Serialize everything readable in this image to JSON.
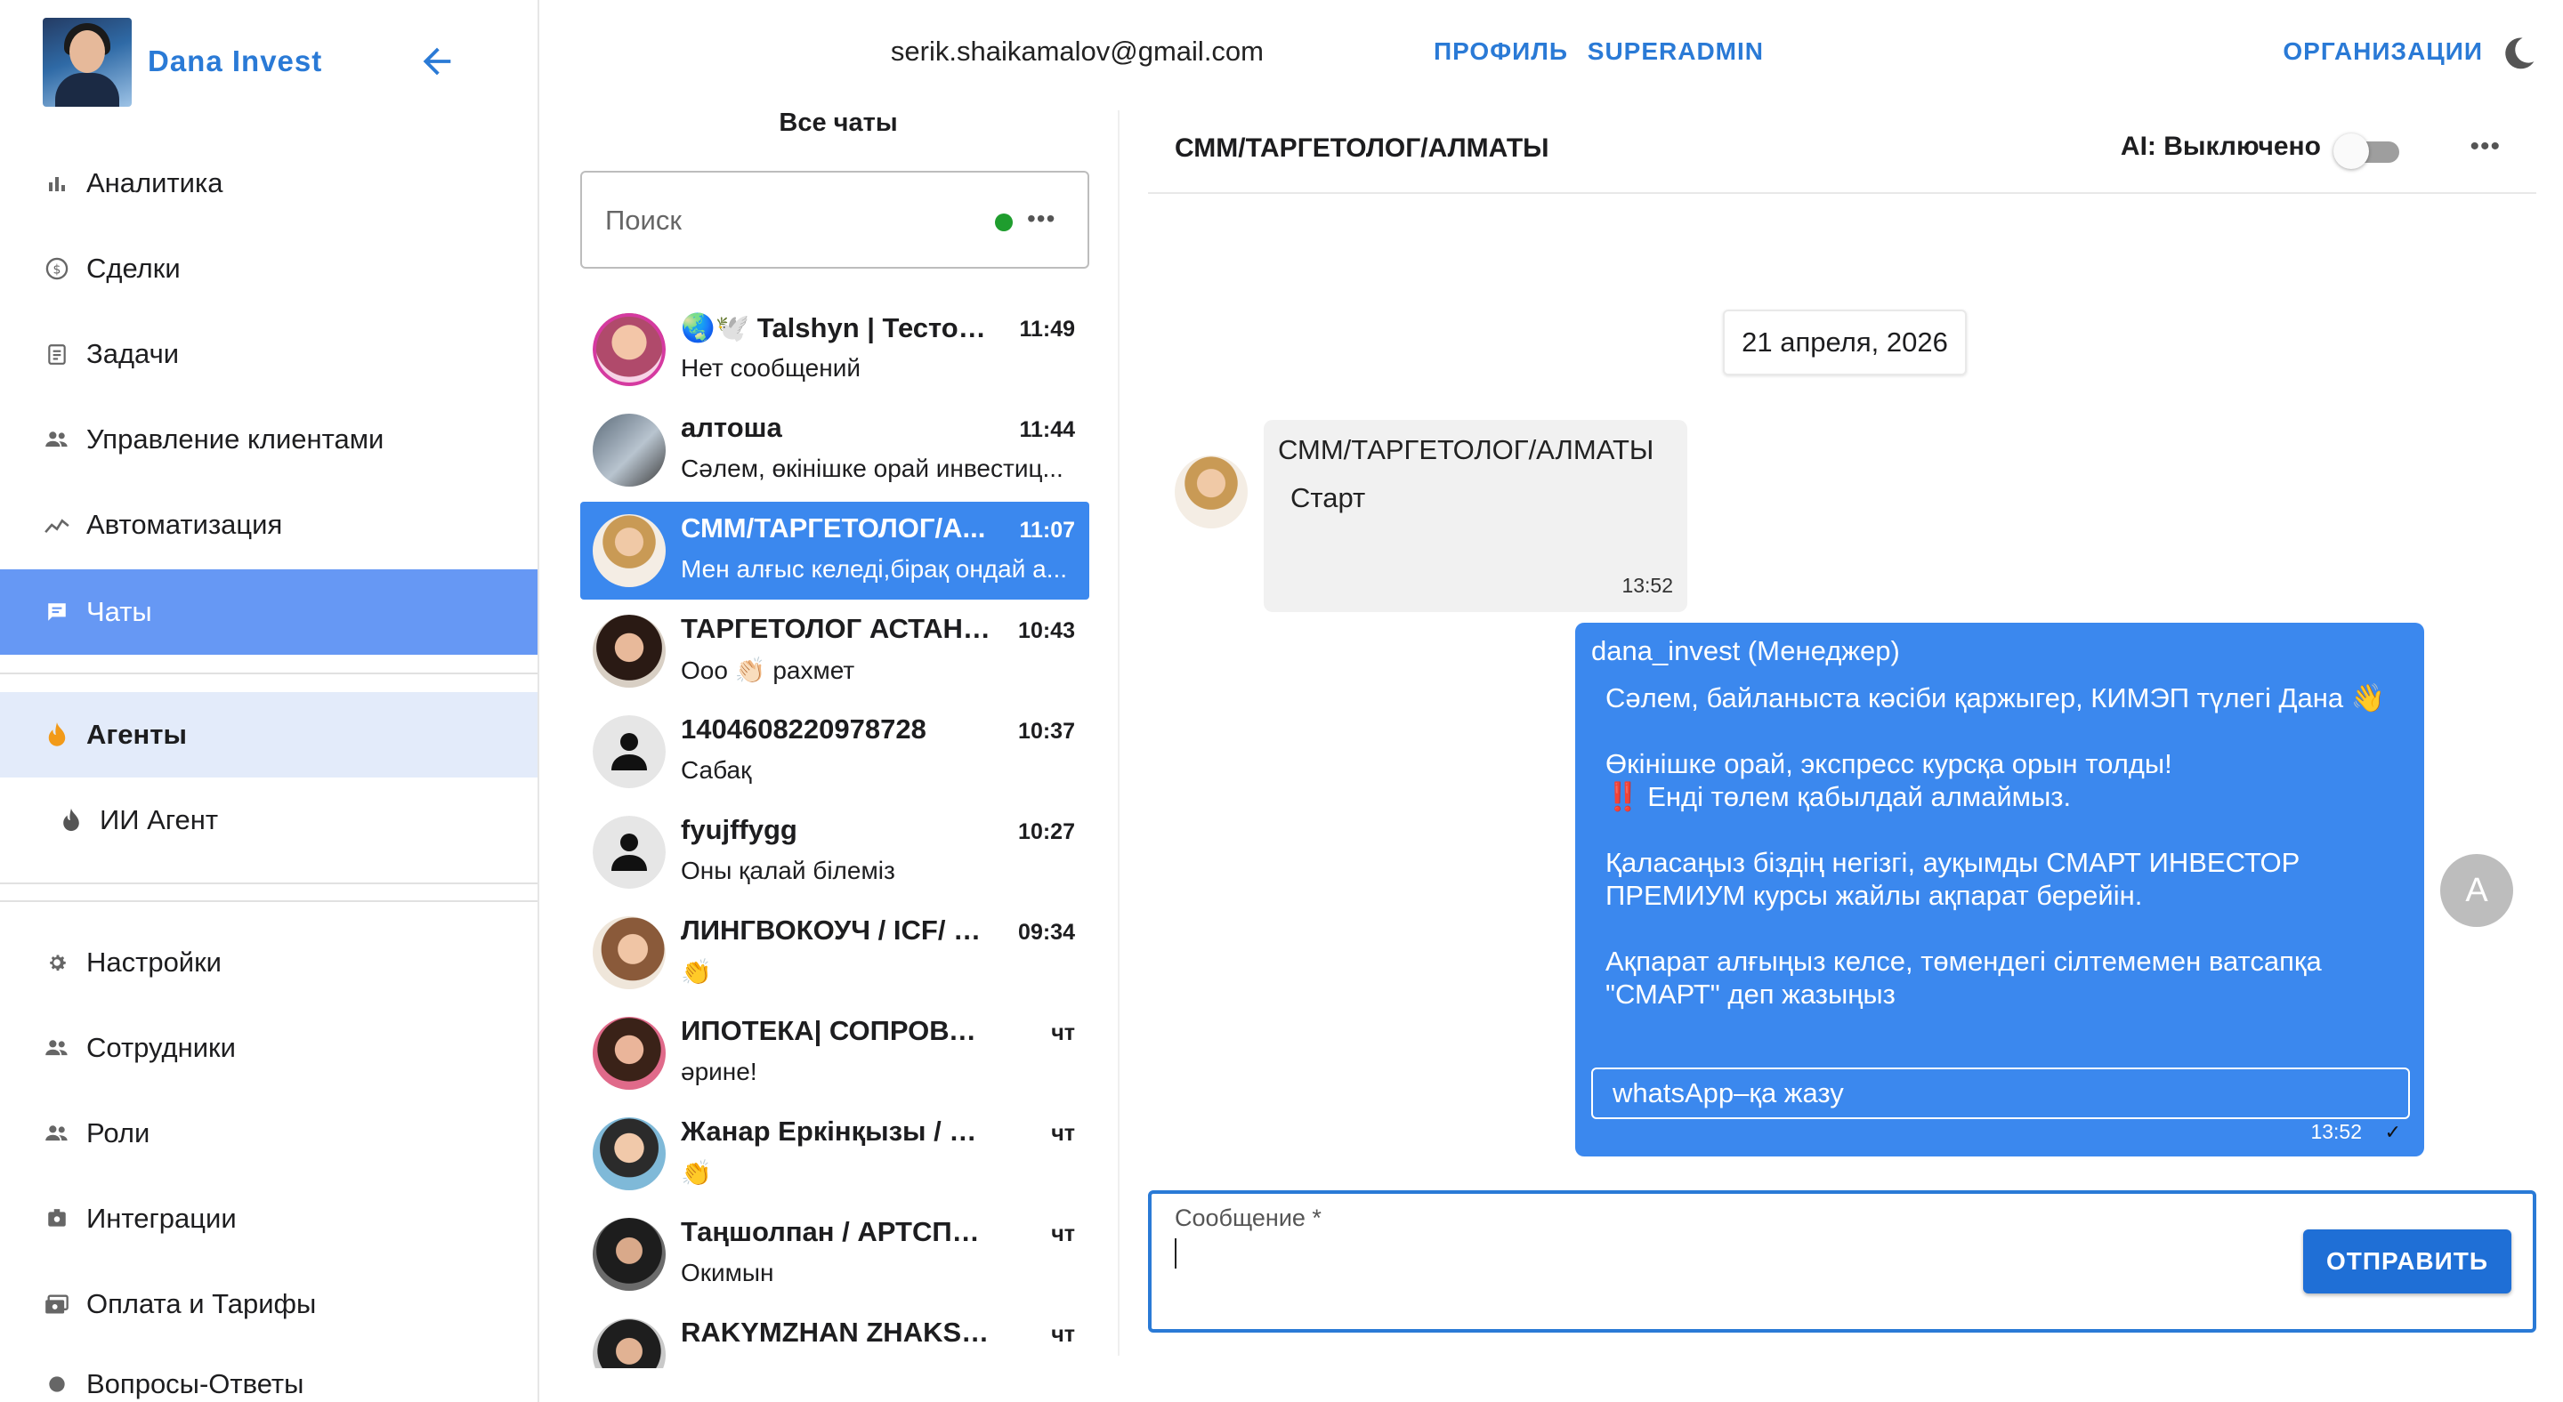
{
  "brand": {
    "name": "Dana Invest"
  },
  "sidebar": {
    "items": [
      {
        "label": "Аналитика",
        "icon": "bar-chart-icon"
      },
      {
        "label": "Сделки",
        "icon": "dollar-circle-icon"
      },
      {
        "label": "Задачи",
        "icon": "clipboard-icon"
      },
      {
        "label": "Управление клиентами",
        "icon": "people-icon"
      },
      {
        "label": "Автоматизация",
        "icon": "trend-icon"
      },
      {
        "label": "Чаты",
        "icon": "chat-icon"
      },
      {
        "label": "Агенты",
        "icon": "flame-icon"
      },
      {
        "label": "ИИ Агент",
        "icon": "drop-icon"
      },
      {
        "label": "Настройки",
        "icon": "gear-icon"
      },
      {
        "label": "Сотрудники",
        "icon": "people-icon"
      },
      {
        "label": "Роли",
        "icon": "people-icon"
      },
      {
        "label": "Интеграции",
        "icon": "integration-icon"
      },
      {
        "label": "Оплата и Тарифы",
        "icon": "payment-icon"
      },
      {
        "label": "Вопросы-Ответы",
        "icon": "gear-icon"
      }
    ]
  },
  "topbar": {
    "email": "serik.shaikamalov@gmail.com",
    "profile": "ПРОФИЛЬ",
    "superadmin": "SUPERADMIN",
    "organizations": "ОРГАНИЗАЦИИ"
  },
  "chatlist": {
    "title": "Все чаты",
    "search_placeholder": "Поиск",
    "status_color": "#1f9d2e",
    "chats": [
      {
        "title": "🌏🕊️ Talshyn | Тесто А...",
        "time": "11:49",
        "preview": "Нет сообщений"
      },
      {
        "title": "алтоша",
        "time": "11:44",
        "preview": "Сәлем, өкінішке орай инвестиц..."
      },
      {
        "title": "СММ/ТАРГЕТОЛОГ/А...",
        "time": "11:07",
        "preview": "Мен алғыс келеді,бірақ ондай а..."
      },
      {
        "title": "ТАРГЕТОЛОГ АСТАНА...",
        "time": "10:43",
        "preview": "Ооо 👏🏻 рахмет"
      },
      {
        "title": "1404608220978728",
        "time": "10:37",
        "preview": "Сабақ"
      },
      {
        "title": "fyujffygg",
        "time": "10:27",
        "preview": "Оны қалай білеміз"
      },
      {
        "title": "ЛИНГВОКОУЧ / ICF/ А...",
        "time": "09:34",
        "preview": "👏"
      },
      {
        "title": "ИПОТЕКА| СОПРОВОЖД...",
        "time": "чт",
        "preview": "әрине!"
      },
      {
        "title": "Жанар Еркінқызы / Пед...",
        "time": "чт",
        "preview": "👏"
      },
      {
        "title": "Таңшолпан / АРТСПОРТ ...",
        "time": "чт",
        "preview": "Окимын"
      },
      {
        "title": "RAKYMZHAN ZHAKSYLYK",
        "time": "чт",
        "preview": ""
      }
    ]
  },
  "conversation": {
    "title": "СММ/ТАРГЕТОЛОГ/АЛМАТЫ",
    "ai_label": "AI: Выключено",
    "date": "21 апреля, 2026",
    "incoming": {
      "sender": "СММ/ТАРГЕТОЛОГ/АЛМАТЫ",
      "text": "Старт",
      "time": "13:52"
    },
    "outgoing": {
      "sender": "dana_invest  (Менеджер)",
      "lines": [
        "Сәлем, байланыста кәсіби қаржыгер, КИМЭП түлегі Дана 👋",
        "",
        "Өкінішке орай, экспресс курсқа орын толды!",
        "‼️ Енді төлем қабылдай алмаймыз.",
        "",
        "Қаласаңыз біздің негізгі, ауқымды СМАРТ ИНВЕСТОР ПРЕМИУМ курсы жайлы ақпарат берейін.",
        "",
        "Ақпарат алғыңыз келсе, төмендегі сілтемемен ватсапқа \"СМАРТ\" деп жазыңыз"
      ],
      "button": "whatsApp–қа жазу",
      "time": "13:52"
    },
    "manager_initial": "A"
  },
  "composer": {
    "label": "Сообщение *",
    "send": "ОТПРАВИТЬ"
  },
  "colors": {
    "accent": "#2a7ad6",
    "active_nav": "#6698f4",
    "selected_chat": "#3b88ee",
    "bubble_out": "#3b88ee"
  }
}
